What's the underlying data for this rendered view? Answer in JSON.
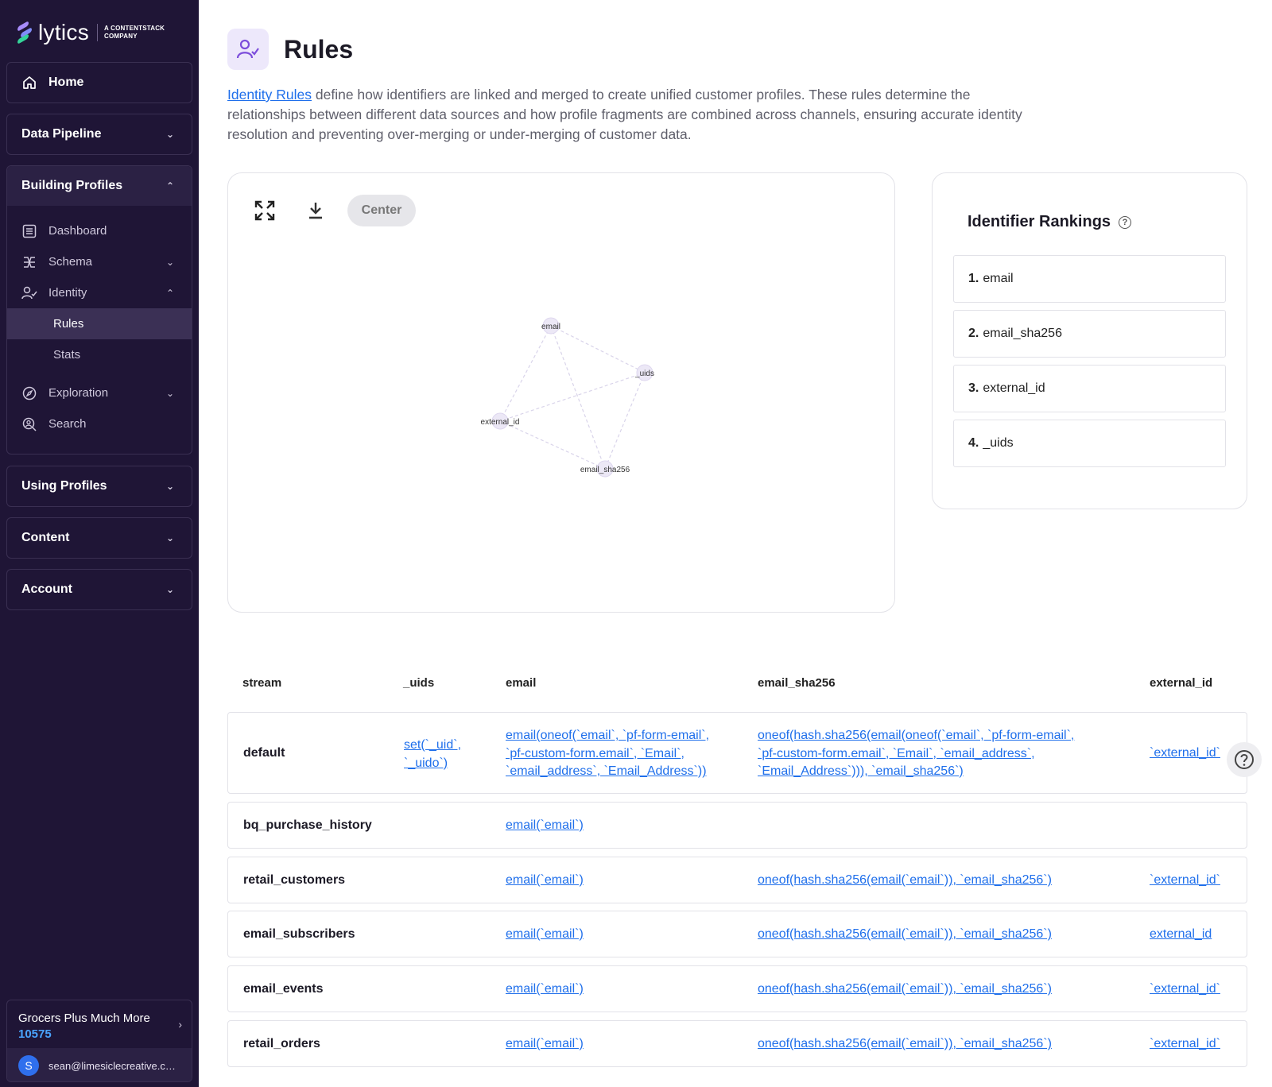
{
  "brand": {
    "name": "lytics",
    "sub": "A CONTENTSTACK COMPANY"
  },
  "sidebar": {
    "home": "Home",
    "data_pipeline": "Data Pipeline",
    "building_profiles": "Building Profiles",
    "items": {
      "dashboard": "Dashboard",
      "schema": "Schema",
      "identity": "Identity",
      "rules": "Rules",
      "stats": "Stats",
      "exploration": "Exploration",
      "search": "Search"
    },
    "using_profiles": "Using Profiles",
    "content": "Content",
    "account": "Account",
    "org": {
      "name": "Grocers Plus Much More",
      "id": "10575"
    },
    "user": {
      "initial": "S",
      "email": "sean@limesiclecreative.com"
    }
  },
  "page": {
    "title": "Rules",
    "description_link": "Identity Rules",
    "description_rest": " define how identifiers are linked and merged to create unified customer profiles. These rules determine the relationships between different data sources and how profile fragments are combined across channels, ensuring accurate identity resolution and preventing over-merging or under-merging of customer data."
  },
  "graph": {
    "center_label": "Center",
    "nodes": [
      {
        "id": "email",
        "label": "email"
      },
      {
        "id": "_uids",
        "label": "_uids"
      },
      {
        "id": "external_id",
        "label": "external_id"
      },
      {
        "id": "email_sha256",
        "label": "email_sha256"
      }
    ]
  },
  "rankings": {
    "title": "Identifier Rankings",
    "items": [
      {
        "num": "1.",
        "name": "email"
      },
      {
        "num": "2.",
        "name": "email_sha256"
      },
      {
        "num": "3.",
        "name": "external_id"
      },
      {
        "num": "4.",
        "name": "_uids"
      }
    ]
  },
  "table": {
    "headers": {
      "stream": "stream",
      "uids": "_uids",
      "email": "email",
      "email_sha256": "email_sha256",
      "external_id": "external_id"
    },
    "rows": [
      {
        "stream": "default",
        "uids": [
          "set(`_uid`,",
          "`_uido`)"
        ],
        "email": [
          "email(oneof(`email`, `pf-form-email`,",
          "`pf-custom-form.email`, `Email`,",
          "`email_address`, `Email_Address`))"
        ],
        "email_sha256": [
          "oneof(hash.sha256(email(oneof(`email`, `pf-form-email`,",
          "`pf-custom-form.email`, `Email`, `email_address`,",
          "`Email_Address`))), `email_sha256`)"
        ],
        "external_id": "`external_id`"
      },
      {
        "stream": "bq_purchase_history",
        "email": "email(`email`)"
      },
      {
        "stream": "retail_customers",
        "email": "email(`email`)",
        "email_sha256": "oneof(hash.sha256(email(`email`)), `email_sha256`)",
        "external_id": "`external_id`"
      },
      {
        "stream": "email_subscribers",
        "email": "email(`email`)",
        "email_sha256": "oneof(hash.sha256(email(`email`)), `email_sha256`)",
        "external_id": "external_id"
      },
      {
        "stream": "email_events",
        "email": "email(`email`)",
        "email_sha256": "oneof(hash.sha256(email(`email`)), `email_sha256`)",
        "external_id": "`external_id`"
      },
      {
        "stream": "retail_orders",
        "email": "email(`email`)",
        "email_sha256": "oneof(hash.sha256(email(`email`)), `email_sha256`)",
        "external_id": "`external_id`"
      }
    ]
  }
}
